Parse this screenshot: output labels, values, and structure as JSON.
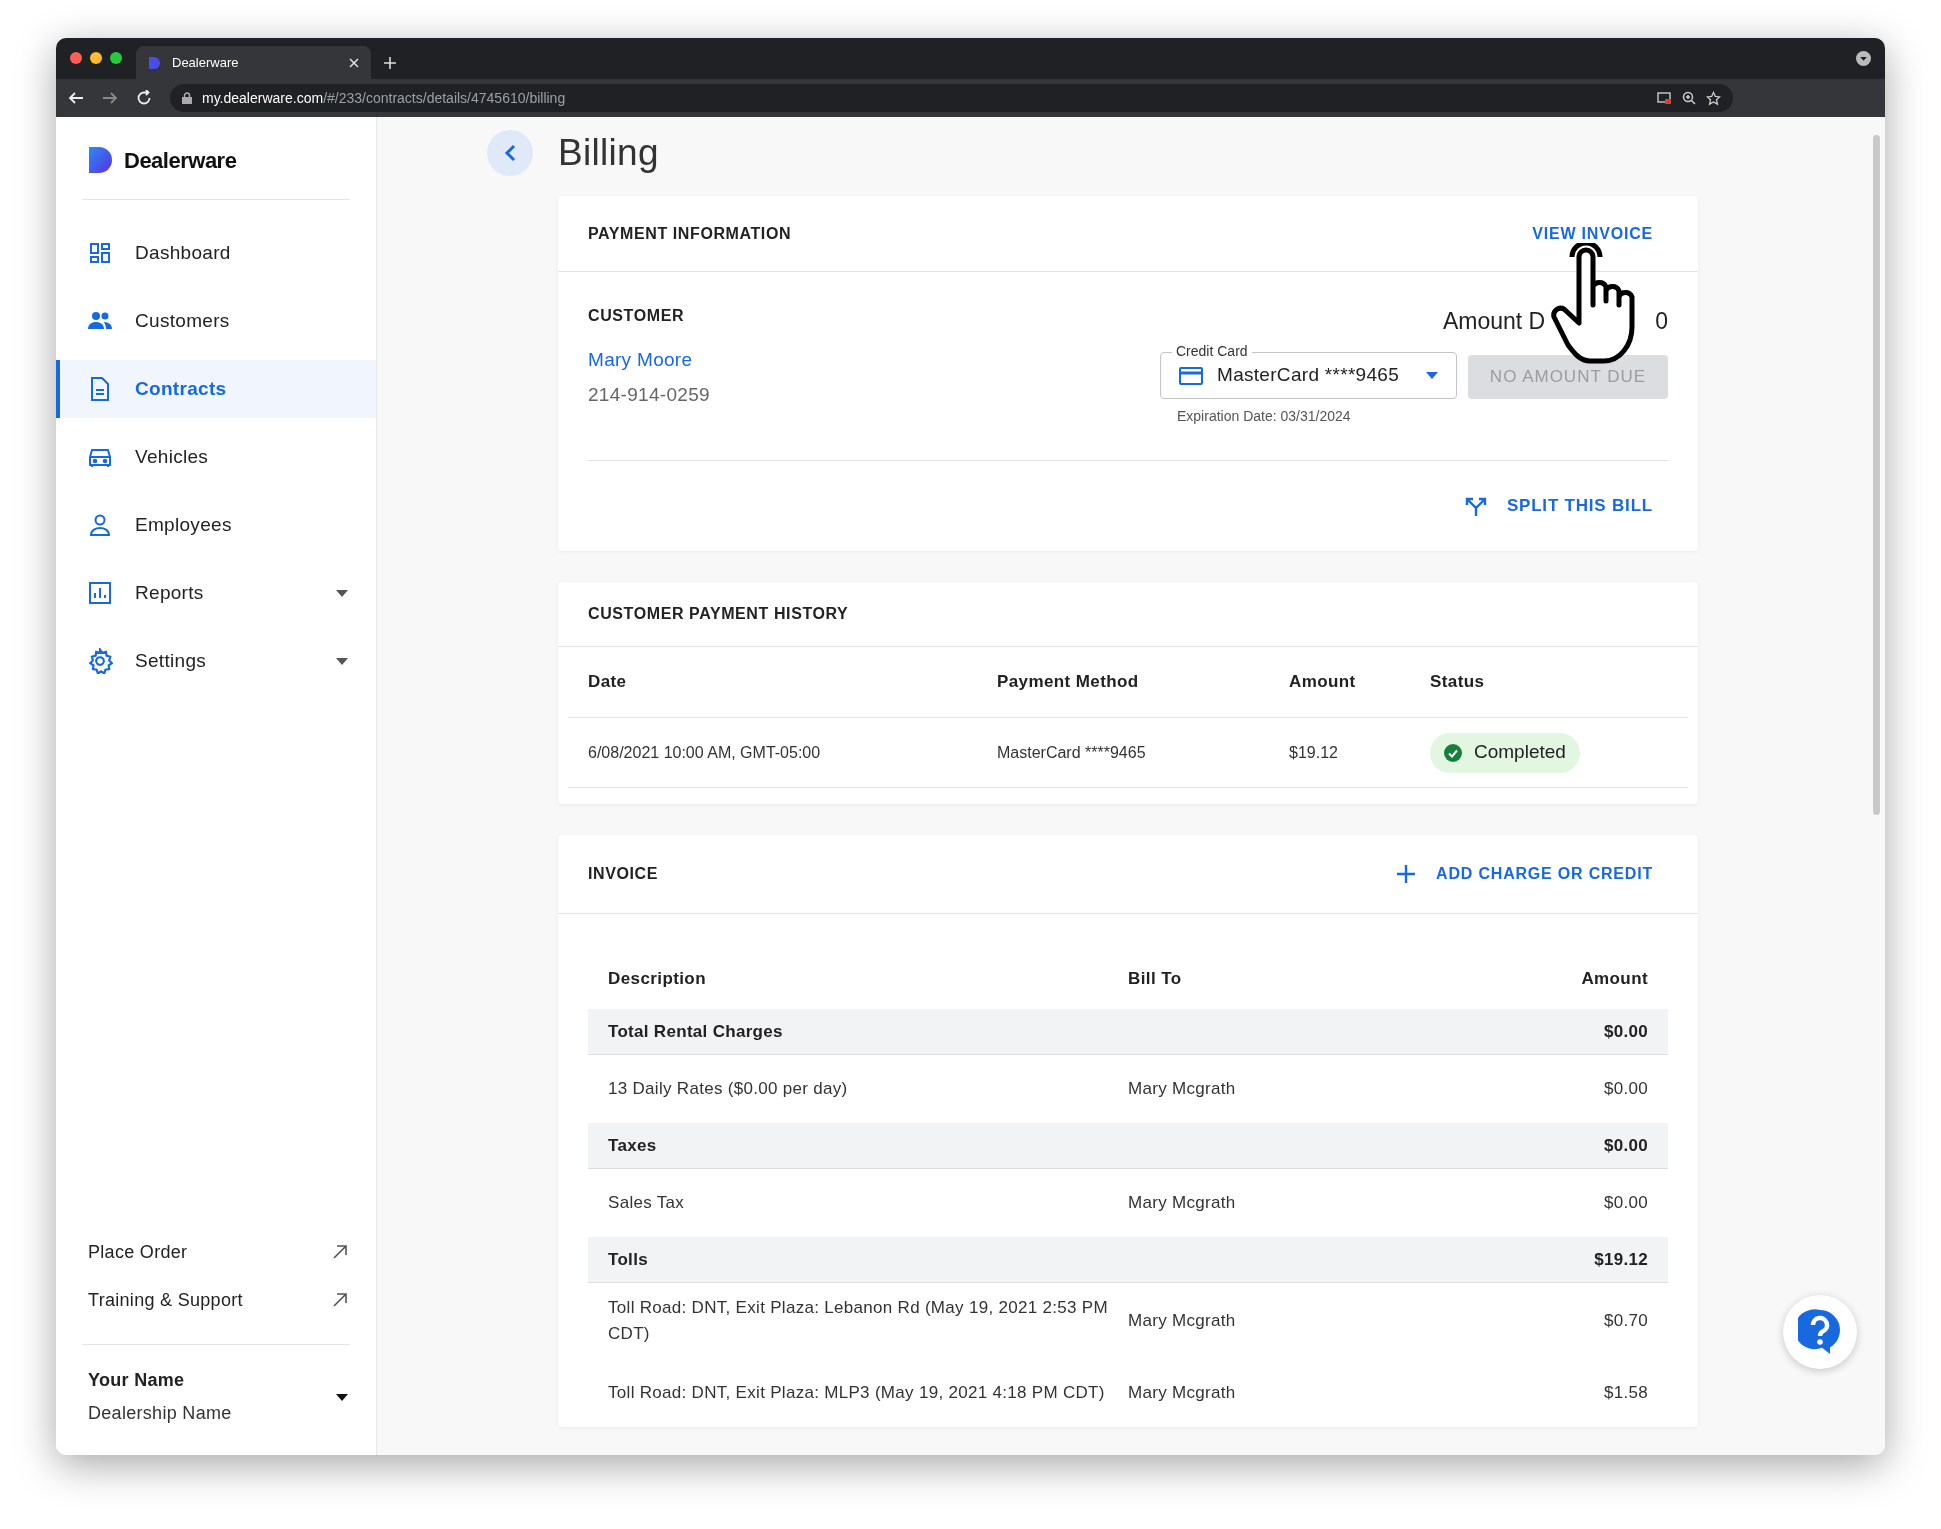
{
  "browser": {
    "tab_title": "Dealerware",
    "url_host": "my.dealerware.com",
    "url_path": "/#/233/contracts/details/4745610/billing"
  },
  "sidebar": {
    "logo": "Dealerware",
    "items": [
      {
        "label": "Dashboard",
        "selected": false,
        "expandable": false
      },
      {
        "label": "Customers",
        "selected": false,
        "expandable": false
      },
      {
        "label": "Contracts",
        "selected": true,
        "expandable": false
      },
      {
        "label": "Vehicles",
        "selected": false,
        "expandable": false
      },
      {
        "label": "Employees",
        "selected": false,
        "expandable": false
      },
      {
        "label": "Reports",
        "selected": false,
        "expandable": true
      },
      {
        "label": "Settings",
        "selected": false,
        "expandable": true
      }
    ],
    "links": [
      {
        "label": "Place Order"
      },
      {
        "label": "Training & Support"
      }
    ],
    "user": {
      "name": "Your Name",
      "dealership": "Dealership Name"
    }
  },
  "page": {
    "title": "Billing"
  },
  "payment_information": {
    "heading": "PAYMENT INFORMATION",
    "action": "VIEW INVOICE",
    "customer_heading": "CUSTOMER",
    "customer_name": "Mary Moore",
    "customer_phone": "214-914-0259",
    "amount_due_start": "Amount D",
    "amount_due_end": "0",
    "card_field": {
      "label": "Credit Card",
      "value": "MasterCard ****9465"
    },
    "pay_button": {
      "label": "NO AMOUNT DUE",
      "disabled": true
    },
    "expiration": "Expiration Date: 03/31/2024",
    "split_action": "SPLIT THIS BILL"
  },
  "payment_history": {
    "heading": "CUSTOMER PAYMENT HISTORY",
    "columns": [
      "Date",
      "Payment Method",
      "Amount",
      "Status"
    ],
    "rows": [
      {
        "date": "6/08/2021 10:00 AM, GMT-05:00",
        "method": "MasterCard ****9465",
        "amount": "$19.12",
        "status": "Completed"
      }
    ]
  },
  "invoice": {
    "heading": "INVOICE",
    "action": "ADD CHARGE OR CREDIT",
    "columns": [
      "Description",
      "Bill To",
      "Amount"
    ],
    "rows": [
      {
        "kind": "group",
        "description": "Total Rental Charges",
        "amount": "$0.00"
      },
      {
        "kind": "item",
        "description": "13 Daily Rates ($0.00 per day)",
        "bill_to": "Mary Mcgrath",
        "amount": "$0.00"
      },
      {
        "kind": "group",
        "description": "Taxes",
        "amount": "$0.00"
      },
      {
        "kind": "item",
        "description": "Sales Tax",
        "bill_to": "Mary Mcgrath",
        "amount": "$0.00"
      },
      {
        "kind": "group",
        "description": "Tolls",
        "amount": "$19.12"
      },
      {
        "kind": "item",
        "description": "Toll Road: DNT, Exit Plaza: Lebanon Rd (May 19, 2021 2:53 PM CDT)",
        "bill_to": "Mary Mcgrath",
        "amount": "$0.70"
      },
      {
        "kind": "item",
        "description": "Toll Road: DNT, Exit Plaza: MLP3 (May 19, 2021 4:18 PM CDT)",
        "bill_to": "Mary Mcgrath",
        "amount": "$1.58"
      }
    ]
  }
}
